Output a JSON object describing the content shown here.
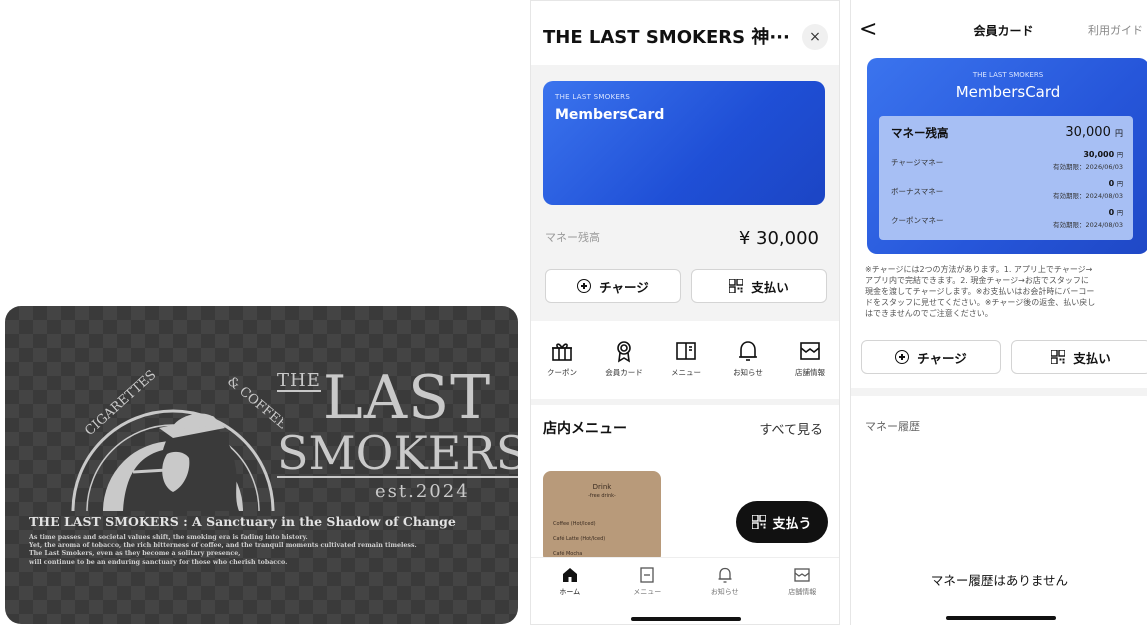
{
  "physical_card": {
    "brand_line1": "LAST",
    "brand_the": "THE",
    "brand_line2": "SMOKERS",
    "est": "est.2024",
    "emblem_left": "CIGARETTES",
    "emblem_right": "& COFFEE",
    "tagline": "THE LAST SMOKERS : A Sanctuary in the Shadow of Change",
    "body": [
      "As time passes and societal values shift, the smoking era is fading into history.",
      "Yet, the aroma of tobacco, the rich bitterness of coffee, and the tranquil moments cultivated remain timeless.",
      "The Last Smokers, even as they become a solitary presence,",
      "will continue to be an enduring sanctuary for those who cherish tobacco."
    ]
  },
  "phone_home": {
    "title": "THE LAST SMOKERS 神···",
    "close_glyph": "×",
    "card_brand": "THE LAST SMOKERS",
    "card_name": "MembersCard",
    "balance_label": "マネー残高",
    "balance_value": "¥ 30,000",
    "charge_button": "チャージ",
    "pay_button": "支払い",
    "shortcuts": [
      {
        "label": "クーポン",
        "icon": "gift-icon"
      },
      {
        "label": "会員カード",
        "icon": "badge-icon"
      },
      {
        "label": "メニュー",
        "icon": "book-icon"
      },
      {
        "label": "お知らせ",
        "icon": "bell-icon"
      },
      {
        "label": "店舗情報",
        "icon": "store-icon"
      }
    ],
    "menu_section_title": "店内メニュー",
    "menu_see_all": "すべて見る",
    "drink_card": {
      "title": "Drink",
      "subtitle": "-free drink-",
      "rows": [
        "Coffee    (Hot/Iced)",
        "Café Latte    (Hot/Iced)",
        "Café Mocha"
      ]
    },
    "fab_label": "支払う",
    "tabs": [
      {
        "label": "ホーム",
        "icon": "home-icon"
      },
      {
        "label": "メニュー",
        "icon": "menu-icon"
      },
      {
        "label": "お知らせ",
        "icon": "bell-icon"
      },
      {
        "label": "店舗情報",
        "icon": "store-icon"
      }
    ]
  },
  "phone_card": {
    "back_glyph": "<",
    "title": "会員カード",
    "guide": "利用ガイド",
    "card_brand": "THE LAST SMOKERS",
    "card_name": "MembersCard",
    "money_balance_label": "マネー残高",
    "money_balance_value": "30,000",
    "yen": "円",
    "rows": [
      {
        "label": "チャージマネー",
        "amount": "30,000",
        "expiry": "有効期限：2026/06/03"
      },
      {
        "label": "ボーナスマネー",
        "amount": "0",
        "expiry": "有効期限：2024/08/03"
      },
      {
        "label": "クーポンマネー",
        "amount": "0",
        "expiry": "有効期限：2024/08/03"
      }
    ],
    "notice_lines": [
      "※チャージには2つの方法があります。1. アプリ上でチャージ→",
      "アプリ内で完結できます。2. 現金チャージ→お店でスタッフに",
      "現金を渡してチャージします。※お支払いはお会計時にバーコー",
      "ドをスタッフに見せてください。※チャージ後の返金、払い戻し",
      "はできませんのでご注意ください。"
    ],
    "charge_button": "チャージ",
    "pay_button": "支払い",
    "history_title": "マネー履歴",
    "history_empty": "マネー履歴はありません"
  },
  "colors": {
    "card_blue": "#2a5fe3",
    "inner_panel": "#a7bff4",
    "card_dark": "#3a3a3a"
  }
}
